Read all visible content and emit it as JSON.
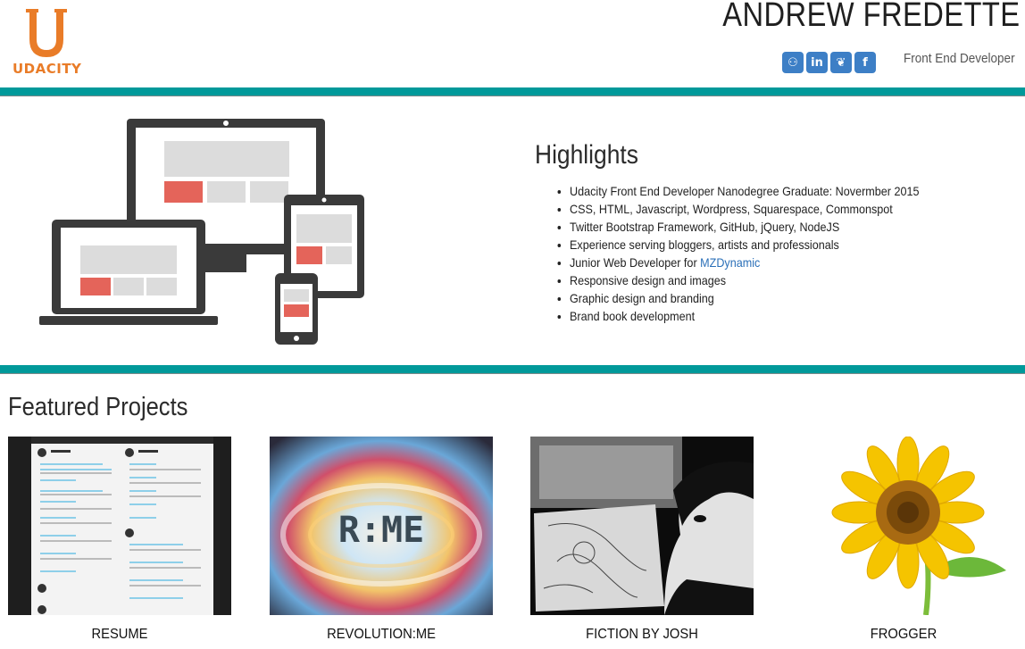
{
  "header": {
    "logo_text": "UDACITY",
    "name": "ANDREW FREDETTE",
    "role": "Front End Developer",
    "social": [
      {
        "icon": "github-icon",
        "glyph": "⚇"
      },
      {
        "icon": "linkedin-icon",
        "glyph": "in"
      },
      {
        "icon": "twitter-icon",
        "glyph": "❦"
      },
      {
        "icon": "facebook-icon",
        "glyph": "f"
      }
    ]
  },
  "highlights": {
    "title": "Highlights",
    "items": [
      "Udacity Front End Developer Nanodegree Graduate: Novermber 2015",
      "CSS, HTML, Javascript, Wordpress, Squarespace, Commonspot",
      "Twitter Bootstrap Framework, GitHub, jQuery, NodeJS",
      "Experience serving bloggers, artists and professionals",
      "Junior Web Developer for ",
      "Responsive design and images",
      "Graphic design and branding",
      "Brand book development"
    ],
    "link_text": "MZDynamic"
  },
  "projects": {
    "title": "Featured Projects",
    "items": [
      {
        "caption": "RESUME"
      },
      {
        "caption": "REVOLUTION:ME",
        "thumb_text": "R:ME"
      },
      {
        "caption": "FICTION BY JOSH"
      },
      {
        "caption": "FROGGER"
      }
    ]
  },
  "colors": {
    "accent": "#00999a",
    "logo": "#e97c28",
    "social": "#3d7fc6",
    "link": "#2a6fb8"
  }
}
